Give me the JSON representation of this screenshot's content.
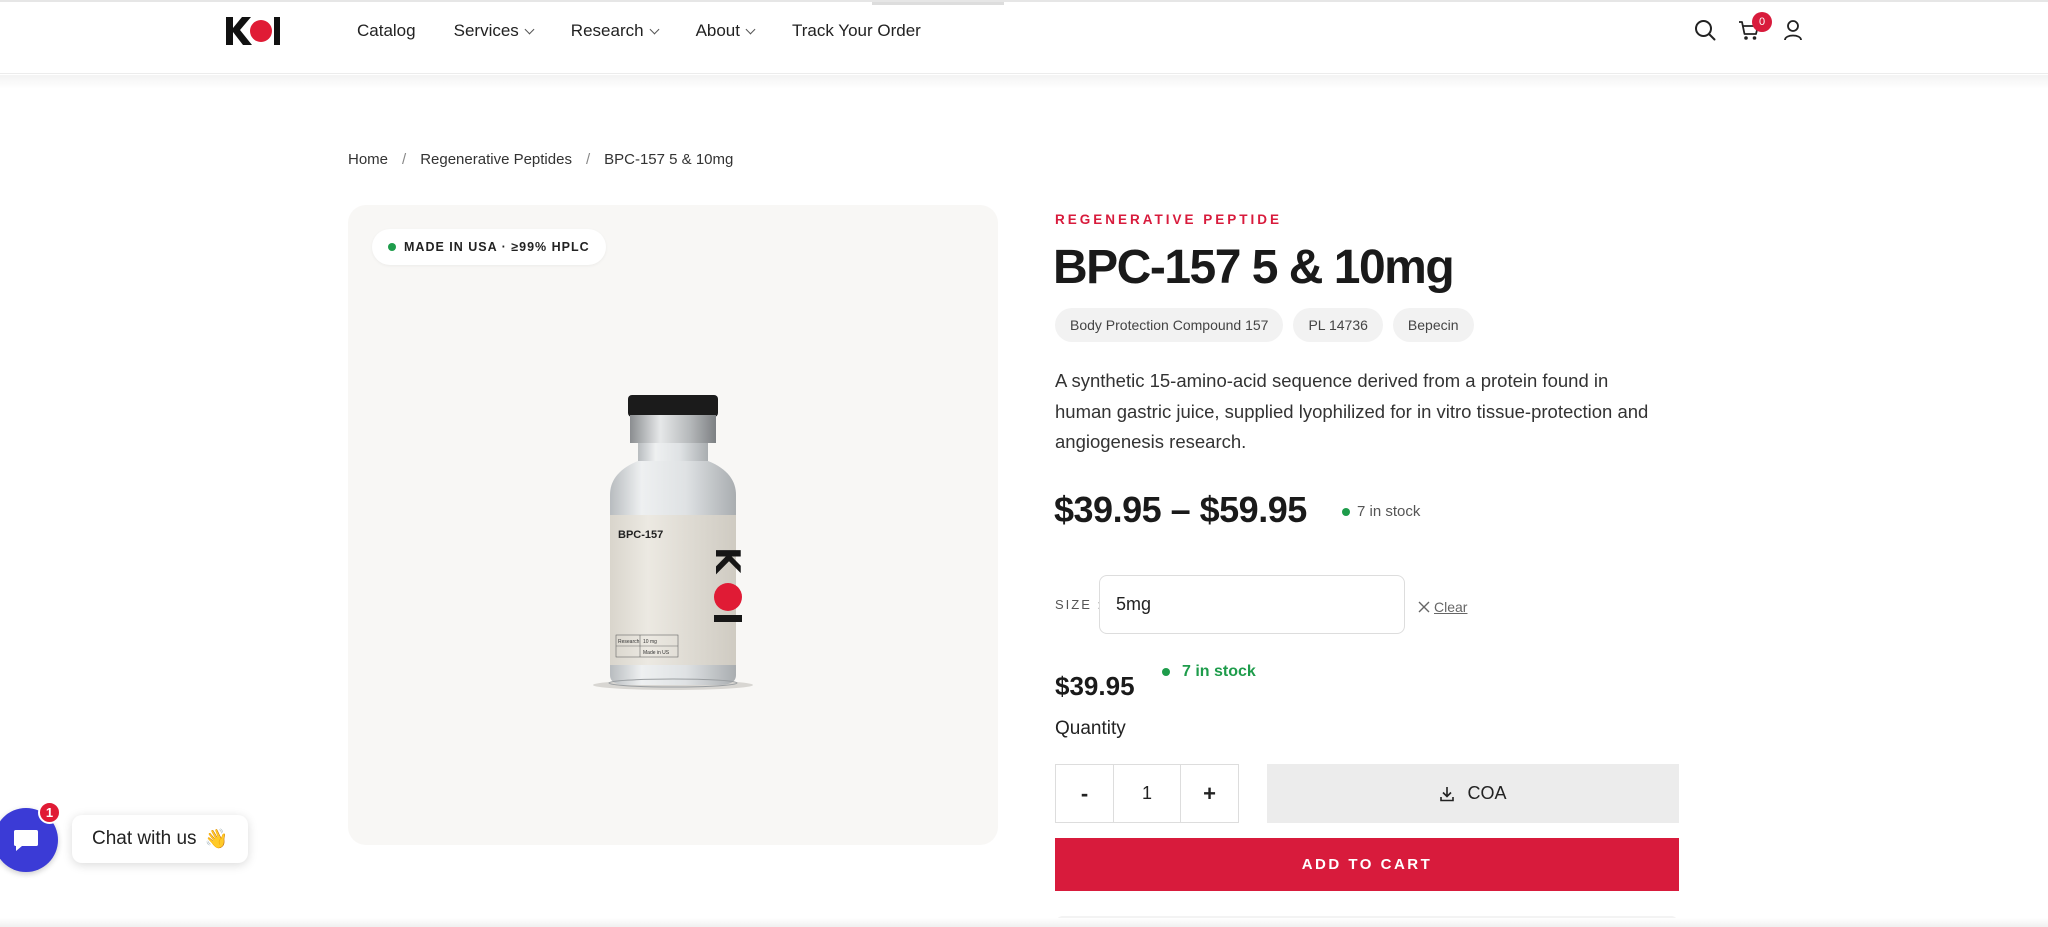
{
  "header": {
    "logo": "KOI",
    "nav": [
      {
        "label": "Catalog",
        "has_dropdown": false
      },
      {
        "label": "Services",
        "has_dropdown": true
      },
      {
        "label": "Research",
        "has_dropdown": true
      },
      {
        "label": "About",
        "has_dropdown": true
      },
      {
        "label": "Track Your Order",
        "has_dropdown": false
      }
    ],
    "cart_count": "0",
    "icons": [
      "search-icon",
      "cart-icon",
      "user-icon"
    ]
  },
  "breadcrumb": [
    {
      "label": "Home"
    },
    {
      "label": "Regenerative Peptides"
    },
    {
      "label": "BPC-157 5 & 10mg"
    }
  ],
  "breadcrumb_separator": "/",
  "image_panel": {
    "badge": "MADE IN USA · ≥99% HPLC",
    "vial_label": "BPC-157",
    "vial_table": [
      "Research",
      "10 mg",
      "Made in US"
    ]
  },
  "product": {
    "eyebrow": "REGENERATIVE PEPTIDE",
    "title": "BPC-157 5 & 10mg",
    "aliases": [
      "Body Protection Compound 157",
      "PL 14736",
      "Bepecin"
    ],
    "description": "A synthetic 15-amino-acid sequence derived from a protein found in human gastric juice, supplied lyophilized for in vitro tissue-protection and angiogenesis research.",
    "price_range": "$39.95 – $59.95",
    "stock_summary": "7 in stock",
    "size_label": "SIZE :",
    "size_value": "5mg",
    "clear_label": "Clear",
    "selected_price": "$39.95",
    "selected_stock": "7 in stock",
    "quantity_label": "Quantity",
    "quantity_value": "1",
    "decrement_label": "-",
    "increment_label": "+",
    "coa_label": "COA",
    "add_to_cart_label": "ADD TO CART"
  },
  "chat": {
    "label": "Chat with us",
    "emoji": "👋",
    "badge": "1"
  },
  "colors": {
    "accent": "#d81b3c",
    "stock_green": "#1e9c4b",
    "chat_blue": "#3b3bd6"
  }
}
